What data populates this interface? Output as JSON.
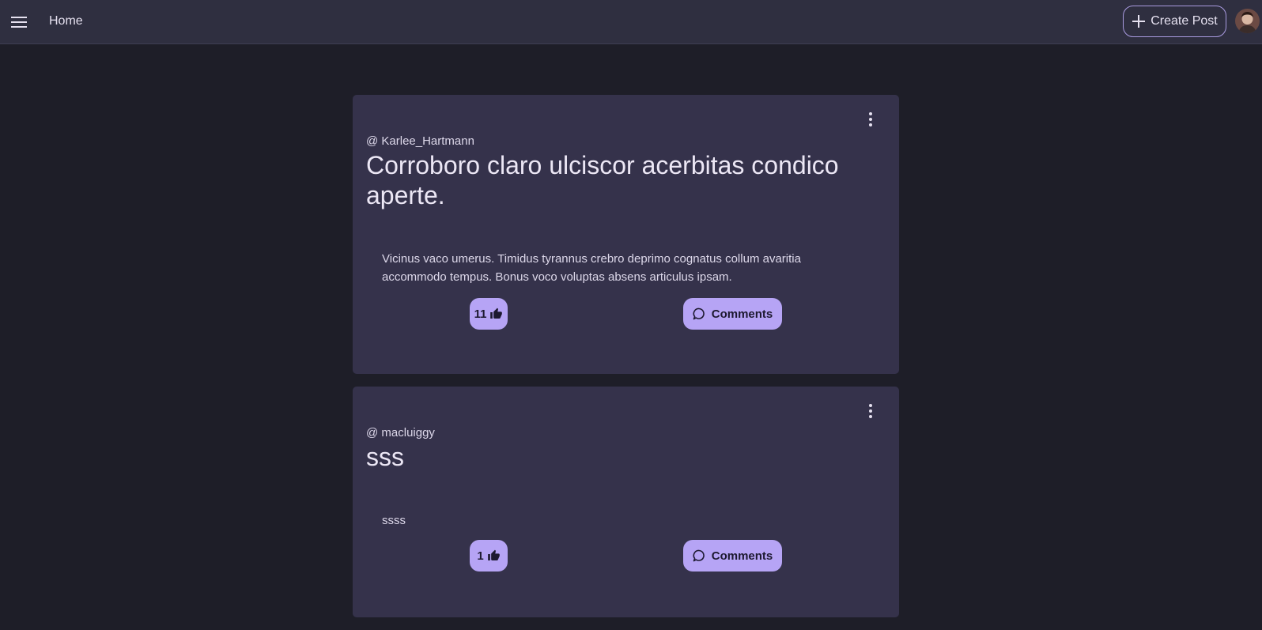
{
  "appbar": {
    "home_label": "Home",
    "create_post_label": "Create Post",
    "menu_icon": "hamburger-menu-icon",
    "plus_icon": "plus-icon"
  },
  "colors": {
    "appbar_bg": "#2f2f40",
    "page_bg": "#1e1e28",
    "card_bg": "#35324b",
    "accent": "#b6a4f5"
  },
  "posts": [
    {
      "author": "@ Karlee_Hartmann",
      "title": "Corroboro claro ulciscor acerbitas condico aperte.",
      "body": "Vicinus vaco umerus. Timidus tyrannus crebro deprimo cognatus collum avaritia accommodo tempus. Bonus voco voluptas absens articulus ipsam.",
      "likes": "11",
      "comments_label": "Comments"
    },
    {
      "author": "@ macluiggy",
      "title": "sss",
      "body": "ssss",
      "likes": "1",
      "comments_label": "Comments"
    }
  ]
}
